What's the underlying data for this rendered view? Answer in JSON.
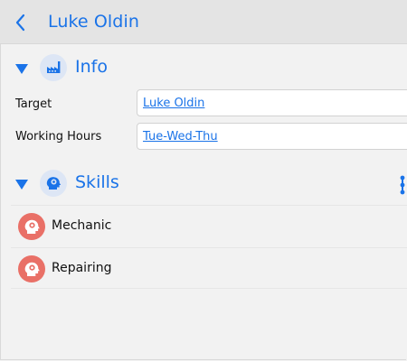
{
  "header": {
    "title": "Luke Oldin",
    "back_icon": "chevron-left-icon"
  },
  "info": {
    "title": "Info",
    "icon": "factory-icon",
    "fields": [
      {
        "label": "Target",
        "value": "Luke Oldin"
      },
      {
        "label": "Working Hours",
        "value": "Tue-Wed-Thu"
      }
    ]
  },
  "skills": {
    "title": "Skills",
    "icon": "head-gear-icon",
    "items": [
      {
        "label": "Mechanic",
        "icon": "head-gear-icon"
      },
      {
        "label": "Repairing",
        "icon": "head-gear-icon"
      }
    ]
  },
  "colors": {
    "accent": "#1a73e8",
    "skill_avatar": "#e97067",
    "header_bg": "#e4e4e4",
    "page_bg": "#f2f2f2"
  }
}
